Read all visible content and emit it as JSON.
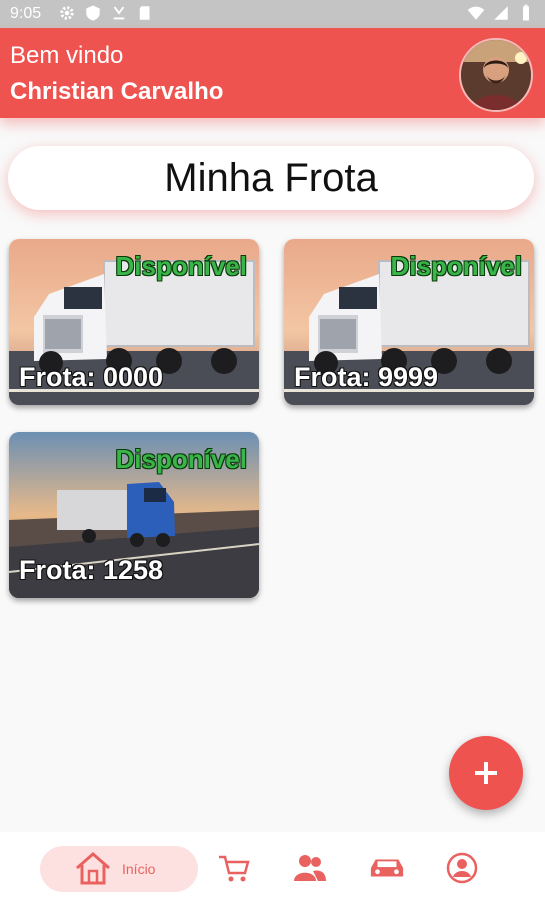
{
  "status_bar": {
    "time": "9:05",
    "left_icons": [
      "gear-icon",
      "shield-icon",
      "download-icon",
      "sd-card-icon"
    ],
    "right_icons": [
      "wifi-icon",
      "signal-icon",
      "battery-icon"
    ]
  },
  "header": {
    "greeting": "Bem vindo",
    "user_name": "Christian Carvalho",
    "background_color": "#ef5350"
  },
  "page_title": "Minha Frota",
  "fleet": [
    {
      "label": "Frota: 0000",
      "status": "Disponível",
      "image": "white-truck-sunset"
    },
    {
      "label": "Frota: 9999",
      "status": "Disponível",
      "image": "white-truck-sunset"
    },
    {
      "label": "Frota: 1258",
      "status": "Disponível",
      "image": "blue-truck-highway"
    }
  ],
  "colors": {
    "accent": "#ef5350",
    "status_available": "#39b54a",
    "nav_active_bg": "#fde1e1"
  },
  "fab": {
    "icon": "plus-icon"
  },
  "bottom_nav": {
    "home_label": "Início",
    "items": [
      "home-icon",
      "cart-icon",
      "users-icon",
      "car-icon",
      "account-icon"
    ]
  }
}
